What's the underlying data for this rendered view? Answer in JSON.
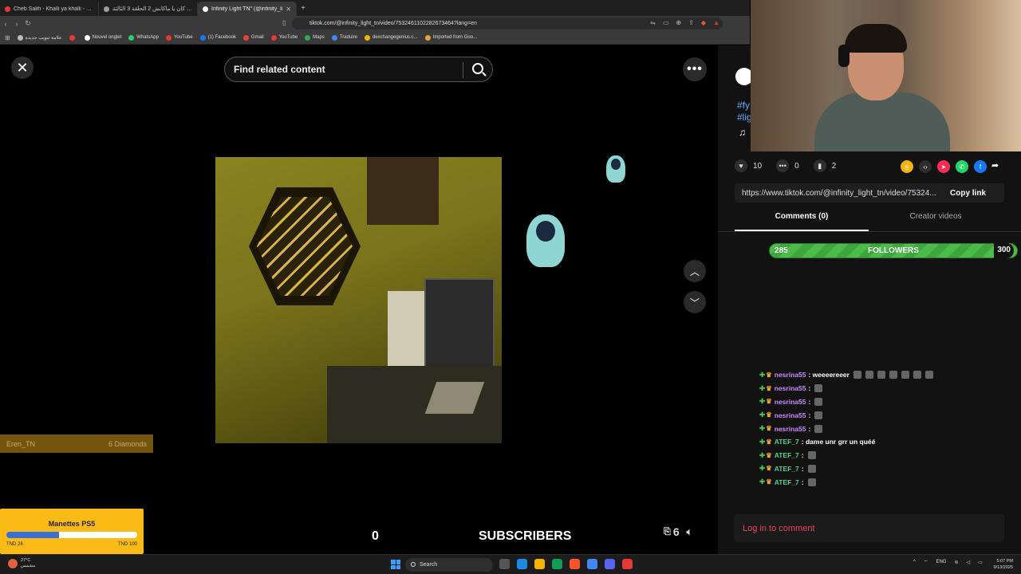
{
  "browser": {
    "tabs": [
      {
        "title": "Cheb Salih - Khalli ya khalli - YouTube",
        "color": "#e53935",
        "active": false
      },
      {
        "title": "مسلسل كان يا ماكانش 2 الحلقة 3 الثالثة",
        "color": "#9e9e9e",
        "active": false
      },
      {
        "title": "Infinity Light TN\" (@infinity_li",
        "color": "#ffffff",
        "active": true
      }
    ],
    "url": "tiktok.com/@infinity_light_tn/video/7532461102282673464?lang=en",
    "bookmarks": [
      {
        "label": "علامة تبويب جديدة",
        "color": "#bbbbbb"
      },
      {
        "label": "",
        "color": "#e53935"
      },
      {
        "label": "Nouvel onglet",
        "color": "#ffffff"
      },
      {
        "label": "WhatsApp",
        "color": "#25d366"
      },
      {
        "label": "YouTube",
        "color": "#e53935"
      },
      {
        "label": "(1) Facebook",
        "color": "#1877f2"
      },
      {
        "label": "Gmail",
        "color": "#ea4335"
      },
      {
        "label": "YouTube",
        "color": "#e53935"
      },
      {
        "label": "Maps",
        "color": "#34a853"
      },
      {
        "label": "Traduire",
        "color": "#4285f4"
      },
      {
        "label": "dexchangegenius.c...",
        "color": "#f4b400"
      },
      {
        "label": "Imported from Goo...",
        "color": "#e6a23c"
      }
    ]
  },
  "player": {
    "search_placeholder": "Find related content",
    "close_glyph": "✕",
    "more_glyph": "•••",
    "up_glyph": "︿",
    "down_glyph": "﹀"
  },
  "overlay": {
    "gift_user": "Eren_TN",
    "gift_value": "6 Diamonds",
    "goal_title": "Manettes PS5",
    "goal_progress": 0.4,
    "goal_min": "TND 26",
    "goal_max": "TND 100",
    "subscribers_count": "0",
    "subscribers_label": "SUBSCRIBERS",
    "side_count": "6",
    "followers_min": "285",
    "followers_label": "FOLLOWERS",
    "followers_max": "300"
  },
  "panel": {
    "tag1": "#fy",
    "tag2": "#lig",
    "music_glyph": "♫",
    "likes": "10",
    "comments": "0",
    "saves": "2",
    "link": "https://www.tiktok.com/@infinity_light_tn/video/75324...",
    "copy_label": "Copy link",
    "tab_comments": "Comments (0)",
    "tab_creator": "Creator videos",
    "login_label": "Log in to comment",
    "share_colors": [
      "#f4b400",
      "#2e2e2e",
      "#fe2c55",
      "#25d366",
      "#1877f2"
    ]
  },
  "chat": [
    {
      "user": "nesrina55",
      "text": ": weeeereeer",
      "color": "#c78bff",
      "emotes": 7
    },
    {
      "user": "nesrina55",
      "text": ":",
      "color": "#c78bff",
      "emotes": 1
    },
    {
      "user": "nesrina55",
      "text": ":",
      "color": "#c78bff",
      "emotes": 1
    },
    {
      "user": "nesrina55",
      "text": ":",
      "color": "#c78bff",
      "emotes": 1
    },
    {
      "user": "nesrina55",
      "text": ":",
      "color": "#c78bff",
      "emotes": 1
    },
    {
      "user": "ATEF_7",
      "text": ": dame unr grr un quéé",
      "color": "#4fd18b",
      "emotes": 0
    },
    {
      "user": "ATEF_7",
      "text": ":",
      "color": "#4fd18b",
      "emotes": 1
    },
    {
      "user": "ATEF_7",
      "text": ":",
      "color": "#4fd18b",
      "emotes": 1
    },
    {
      "user": "ATEF_7",
      "text": ":",
      "color": "#4fd18b",
      "emotes": 1
    }
  ],
  "taskbar": {
    "temp": "27°C",
    "weather": "مشمس",
    "search": "Search",
    "lang": "ENG",
    "time": "5:07 PM",
    "date": "9/13/2025",
    "app_colors": [
      "#555555",
      "#1e88e5",
      "#f4b400",
      "#0f9d58",
      "#fb542b",
      "#4285f4",
      "#5865f2",
      "#e53935"
    ]
  }
}
